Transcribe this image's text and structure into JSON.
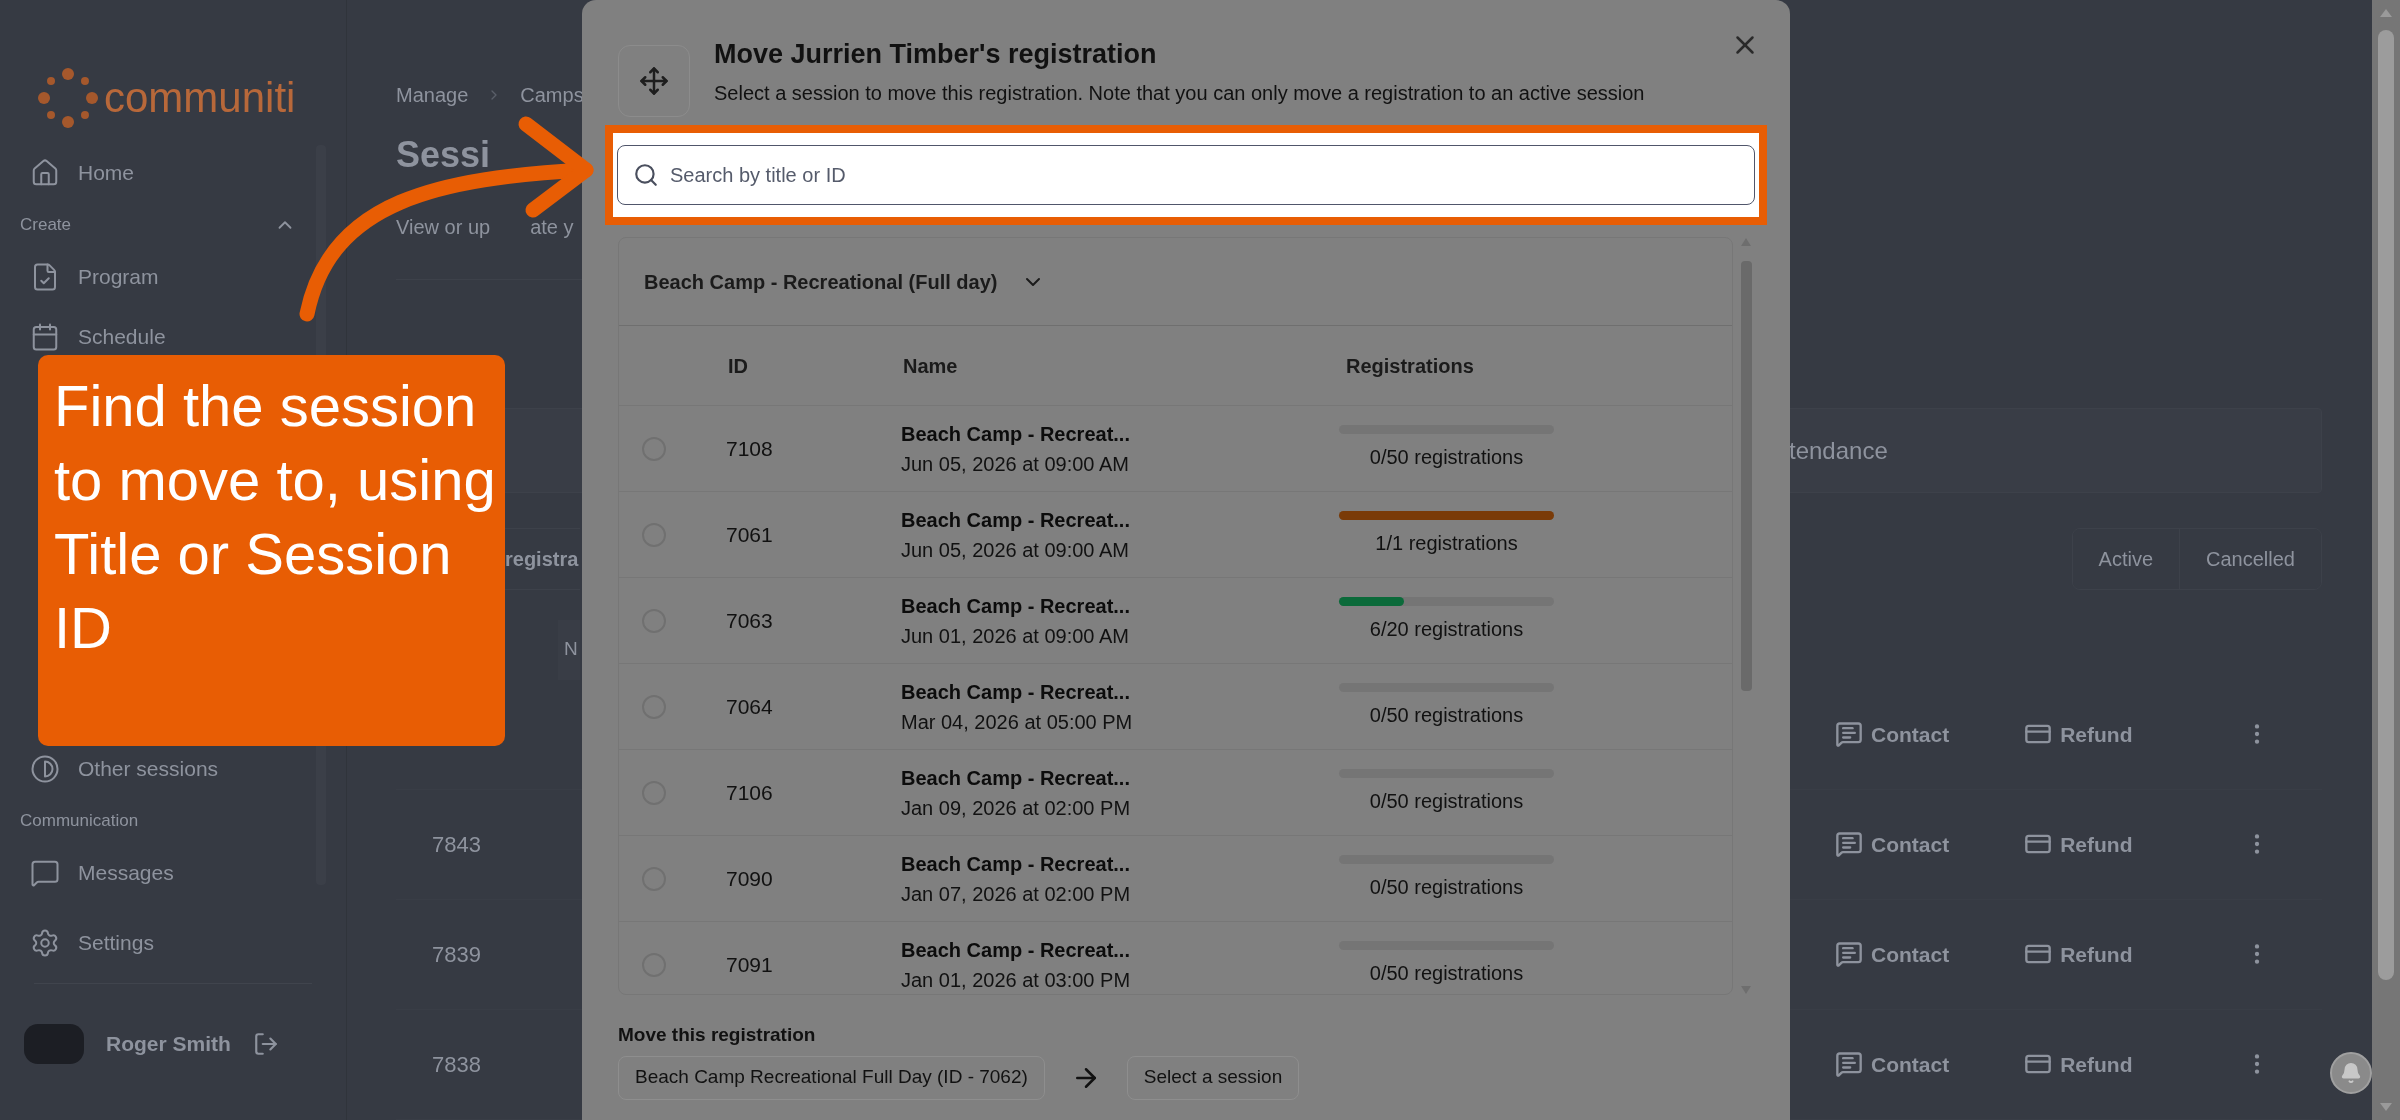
{
  "sidebar": {
    "logo_text": "communiti",
    "home": {
      "label": "Home"
    },
    "create": {
      "label": "Create",
      "expanded": true,
      "items": [
        {
          "label": "Program"
        },
        {
          "label": "Schedule"
        }
      ]
    },
    "other": {
      "label": "Other sessions"
    },
    "communication": {
      "label": "Communication",
      "items": [
        {
          "label": "Messages"
        }
      ]
    },
    "settings": {
      "label": "Settings"
    },
    "user": {
      "name": "Roger Smith"
    }
  },
  "page": {
    "breadcrumb": [
      "Manage",
      "Camps"
    ],
    "heading": "Sessi",
    "subtitle": [
      "View or up",
      "ate y"
    ],
    "band_text": "tendance",
    "tab_text": "registra",
    "filters": [
      {
        "label": "Active",
        "selected": false
      },
      {
        "label": "Cancelled",
        "selected": false
      }
    ],
    "column_heading": "N",
    "rows": [
      {
        "contact": "Contact",
        "refund": "Refund"
      },
      {
        "id": "7843",
        "contact": "Contact",
        "refund": "Refund"
      },
      {
        "id": "7839",
        "contact": "Contact",
        "refund": "Refund"
      },
      {
        "id": "7838",
        "contact": "Contact",
        "refund": "Refund"
      }
    ]
  },
  "modal": {
    "title": "Move Jurrien Timber's registration",
    "description": "Select a session to move this registration. Note that you can only move a registration to an active session",
    "search": {
      "placeholder": "Search by title or ID"
    },
    "group": {
      "title": "Beach Camp - Recreational (Full day)",
      "expanded": true
    },
    "columns": [
      "ID",
      "Name",
      "Registrations"
    ],
    "sessions": [
      {
        "id": "7108",
        "name": "Beach Camp - Recreat...",
        "date": "Jun 05, 2026 at 09:00 AM",
        "level": 0,
        "reading": "0/50 registrations",
        "selected": false
      },
      {
        "id": "7061",
        "name": "Beach Camp - Recreat...",
        "date": "Jun 05, 2026 at 09:00 AM",
        "level": 1,
        "reading": "1/1 registrations",
        "selected": false
      },
      {
        "id": "7063",
        "name": "Beach Camp - Recreat...",
        "date": "Jun 01, 2026 at 09:00 AM",
        "level": 0.3,
        "reading": "6/20 registrations",
        "selected": false
      },
      {
        "id": "7064",
        "name": "Beach Camp - Recreat...",
        "date": "Mar 04, 2026 at 05:00 PM",
        "level": 0,
        "reading": "0/50 registrations",
        "selected": false
      },
      {
        "id": "7106",
        "name": "Beach Camp - Recreat...",
        "date": "Jan 09, 2026 at 02:00 PM",
        "level": 0,
        "reading": "0/50 registrations",
        "selected": false
      },
      {
        "id": "7090",
        "name": "Beach Camp - Recreat...",
        "date": "Jan 07, 2026 at 02:00 PM",
        "level": 0,
        "reading": "0/50 registrations",
        "selected": false
      },
      {
        "id": "7091",
        "name": "Beach Camp - Recreat...",
        "date": "Jan 01, 2026 at 03:00 PM",
        "level": 0,
        "reading": "0/50 registrations",
        "selected": false
      }
    ],
    "footer": {
      "label": "Move this registration",
      "from": "Beach Camp Recreational Full Day (ID - 7062)",
      "to": "Select a session"
    }
  },
  "callout": {
    "text": "Find the session to move to, using Title or Session ID"
  }
}
